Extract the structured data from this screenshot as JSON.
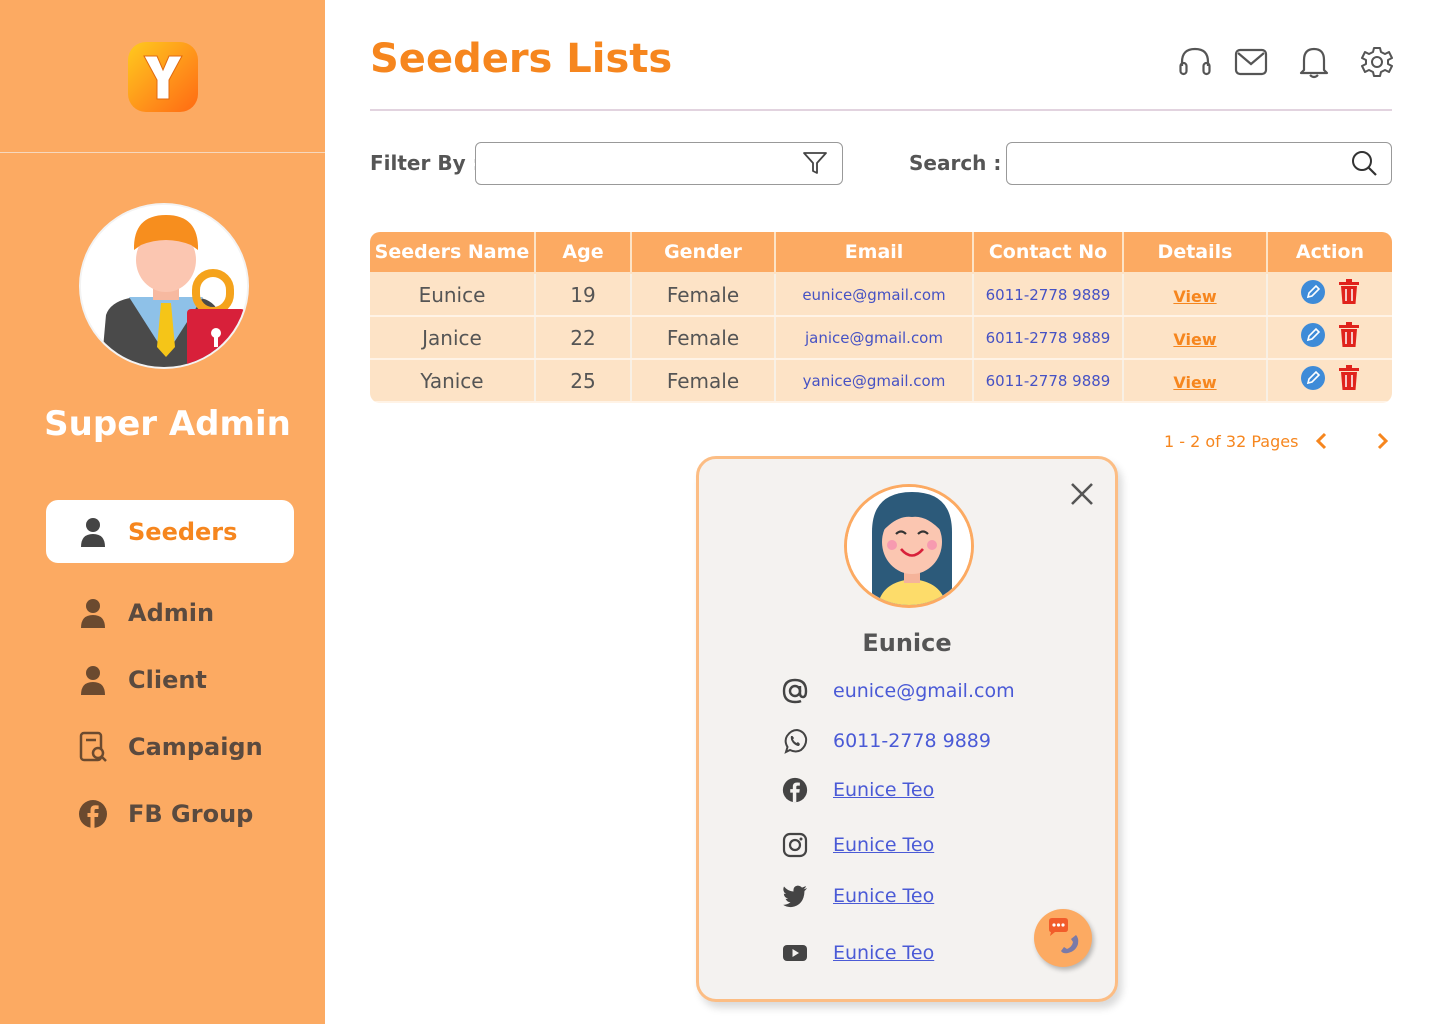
{
  "brand": {
    "logo_letter": "Y",
    "logo_color": "#ff8f1a"
  },
  "sidebar": {
    "role_title": "Super Admin",
    "items": [
      {
        "label": "Seeders",
        "icon": "person-icon",
        "active": true
      },
      {
        "label": "Admin",
        "icon": "person-icon"
      },
      {
        "label": "Client",
        "icon": "person-icon"
      },
      {
        "label": "Campaign",
        "icon": "document-search-icon"
      },
      {
        "label": "FB Group",
        "icon": "facebook-icon"
      }
    ]
  },
  "header": {
    "title": "Seeders Lists",
    "icons": [
      "headset-icon",
      "mail-icon",
      "bell-icon",
      "gear-icon"
    ]
  },
  "filters": {
    "filter_label": "Filter By :",
    "filter_value": "",
    "search_label": "Search :",
    "search_value": ""
  },
  "table": {
    "columns": [
      "Seeders Name",
      "Age",
      "Gender",
      "Email",
      "Contact No",
      "Details",
      "Action"
    ],
    "rows": [
      {
        "name": "Eunice",
        "age": "19",
        "gender": "Female",
        "email": "eunice@gmail.com",
        "contact": "6011-2778 9889",
        "details": "View"
      },
      {
        "name": "Janice",
        "age": "22",
        "gender": "Female",
        "email": "janice@gmail.com",
        "contact": "6011-2778 9889",
        "details": "View"
      },
      {
        "name": "Yanice",
        "age": "25",
        "gender": "Female",
        "email": "yanice@gmail.com",
        "contact": "6011-2778 9889",
        "details": "View"
      }
    ]
  },
  "pagination": {
    "text": "1 - 2 of 32 Pages"
  },
  "modal": {
    "name": "Eunice",
    "email": "eunice@gmail.com",
    "phone": "6011-2778 9889",
    "facebook": "Eunice Teo",
    "instagram": "Eunice Teo",
    "twitter": "Eunice Teo",
    "youtube": "Eunice Teo"
  },
  "colors": {
    "sidebar_bg": "#fcaa62",
    "accent": "#f6861e",
    "row_bg": "#fde3c6",
    "link_blue": "#4a5ad6",
    "delete_red": "#e0231c",
    "edit_blue": "#3e8bd8"
  }
}
